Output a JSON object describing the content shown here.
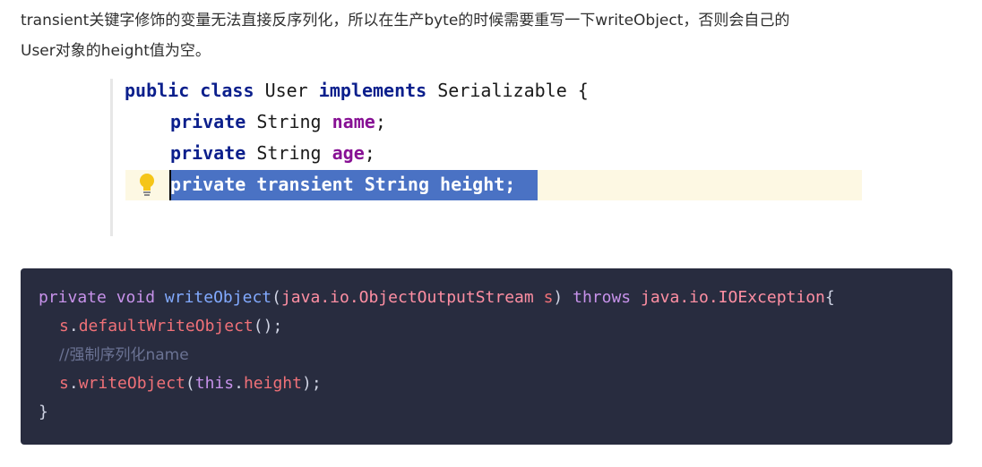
{
  "paragraph": {
    "line1": "transient关键字修饰的变量无法直接反序列化，所以在生产byte的时候需要重写一下writeObject，否则会自己的",
    "line2": "User对象的height值为空。"
  },
  "ide_snippet": {
    "line1": {
      "kw1": "public",
      "kw2": "class",
      "name": "User",
      "kw3": "implements",
      "iface": "Serializable",
      "brace": "{"
    },
    "line2": {
      "kw": "private",
      "type": "String",
      "field": "name",
      "semi": ";"
    },
    "line3": {
      "kw": "private",
      "type": "String",
      "field": "age",
      "semi": ";"
    },
    "line4": {
      "text": "private transient String height;"
    },
    "icons": {
      "bulb": "lightbulb-icon"
    },
    "colors": {
      "selection": "#4a72c4",
      "current_line": "#fdf8e3",
      "keyword": "#0b1f8c",
      "field": "#871094"
    }
  },
  "code_block": {
    "line1": {
      "kw_private": "private",
      "kw_void": "void",
      "method": "writeObject",
      "open": "(",
      "param_type": "java.io.ObjectOutputStream",
      "param_name": "s",
      "close": ")",
      "kw_throws": "throws",
      "exception": "java.io.IOException",
      "brace": "{"
    },
    "line2": {
      "obj": "s",
      "dot": ".",
      "method": "defaultWriteObject",
      "rest": "();"
    },
    "line3": {
      "comment": "//强制序列化name"
    },
    "line4": {
      "obj": "s",
      "dot": ".",
      "method": "writeObject",
      "open": "(",
      "this_kw": "this",
      "dot2": ".",
      "field": "height",
      "rest": ");"
    },
    "line5": {
      "brace": "}"
    },
    "colors": {
      "background": "#282c3f",
      "keyword": "#c792ea",
      "function": "#82aaff",
      "identifier": "#f07178"
    }
  }
}
